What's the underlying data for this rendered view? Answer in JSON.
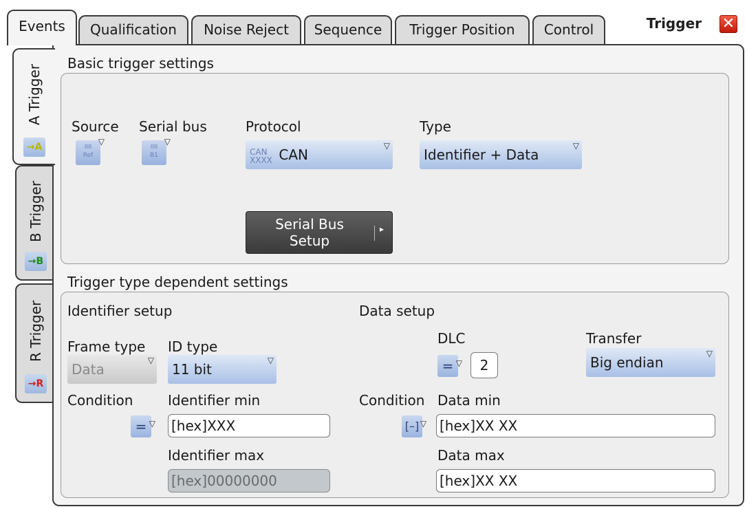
{
  "tabs": [
    "Events",
    "Qualification",
    "Noise Reject",
    "Sequence",
    "Trigger Position",
    "Control"
  ],
  "title": "Trigger",
  "close_glyph": "✕",
  "side_tabs": [
    {
      "label": "A Trigger",
      "icon_letter": "A",
      "icon_color": "#e6e600"
    },
    {
      "label": "B Trigger",
      "icon_letter": "B",
      "icon_color": "#1f8a1f"
    },
    {
      "label": "R Trigger",
      "icon_letter": "R",
      "icon_color": "#cc2222"
    }
  ],
  "basic": {
    "heading": "Basic trigger settings",
    "source_label": "Source",
    "serial_bus_label": "Serial bus",
    "protocol_label": "Protocol",
    "protocol_value": "CAN",
    "protocol_icon_text": "CAN",
    "type_label": "Type",
    "type_value": "Identifier + Data",
    "serial_bus_setup_line1": "Serial Bus",
    "serial_bus_setup_line2": "Setup"
  },
  "dependent": {
    "heading": "Trigger type dependent settings",
    "identifier": {
      "heading": "Identifier setup",
      "frame_type_label": "Frame type",
      "frame_type_value": "Data",
      "id_type_label": "ID type",
      "id_type_value": "11 bit",
      "condition_label": "Condition",
      "condition_symbol": "=",
      "id_min_label": "Identifier min",
      "id_min_value": "[hex]XXX",
      "id_max_label": "Identifier max",
      "id_max_value": "[hex]00000000"
    },
    "data": {
      "heading": "Data setup",
      "dlc_label": "DLC",
      "dlc_symbol": "=",
      "dlc_value": "2",
      "transfer_label": "Transfer",
      "transfer_value": "Big endian",
      "condition_label": "Condition",
      "condition_symbol": "[–]",
      "data_min_label": "Data min",
      "data_min_value": "[hex]XX XX",
      "data_max_label": "Data max",
      "data_max_value": "[hex]XX XX"
    }
  },
  "dropdown_glyph": "▽",
  "tab_arrow_glyph": "▸"
}
